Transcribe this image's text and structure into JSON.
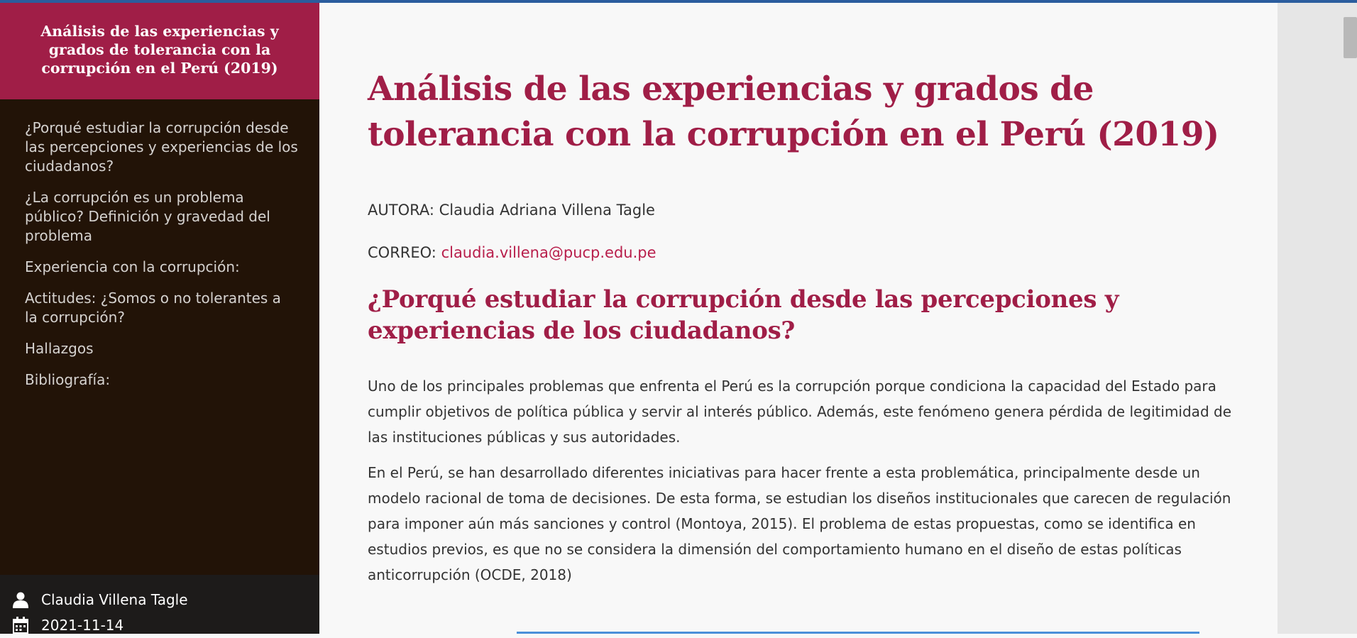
{
  "sidebar": {
    "title": "Análisis de las experiencias y grados de tolerancia con la corrupción en el Perú (2019)",
    "toc": [
      "¿Porqué estudiar la corrupción desde las percepciones y experiencias de los ciudadanos?",
      "¿La corrupción es un problema público? Definición y gravedad del problema",
      "Experiencia con la corrupción:",
      "Actitudes: ¿Somos o no tolerantes a la corrupción?",
      "Hallazgos",
      "Bibliografía:"
    ],
    "author": "Claudia Villena Tagle",
    "date": "2021-11-14"
  },
  "main": {
    "title": "Análisis de las experiencias y grados de tolerancia con la corrupción en el Perú (2019)",
    "author_line": "AUTORA: Claudia Adriana Villena Tagle",
    "email_label": "CORREO: ",
    "email": "claudia.villena@pucp.edu.pe",
    "section_title": "¿Porqué estudiar la corrupción desde las percepciones y experiencias de los ciudadanos?",
    "paragraphs": [
      "Uno de los principales problemas que enfrenta el Perú es la corrupción porque condiciona la capacidad del Estado para cumplir objetivos de política pública y servir al interés público. Además, este fenómeno genera pérdida de legitimidad de las instituciones públicas y sus autoridades.",
      "En el Perú, se han desarrollado diferentes iniciativas para hacer frente a esta problemática, principalmente desde un modelo racional de toma de decisiones. De esta forma, se estudian los diseños institucionales que carecen de regulación para imponer aún más sanciones y control (Montoya, 2015). El problema de estas propuestas, como se identifica en estudios previos, es que no se considera la dimensión del comportamiento humano en el diseño de estas políticas anticorrupción (OCDE, 2018)"
    ]
  },
  "colors": {
    "accent": "#a01e47",
    "sidebar_bg": "#221307",
    "link": "#b81e4b"
  },
  "icons": [
    "user-icon",
    "calendar-icon"
  ]
}
